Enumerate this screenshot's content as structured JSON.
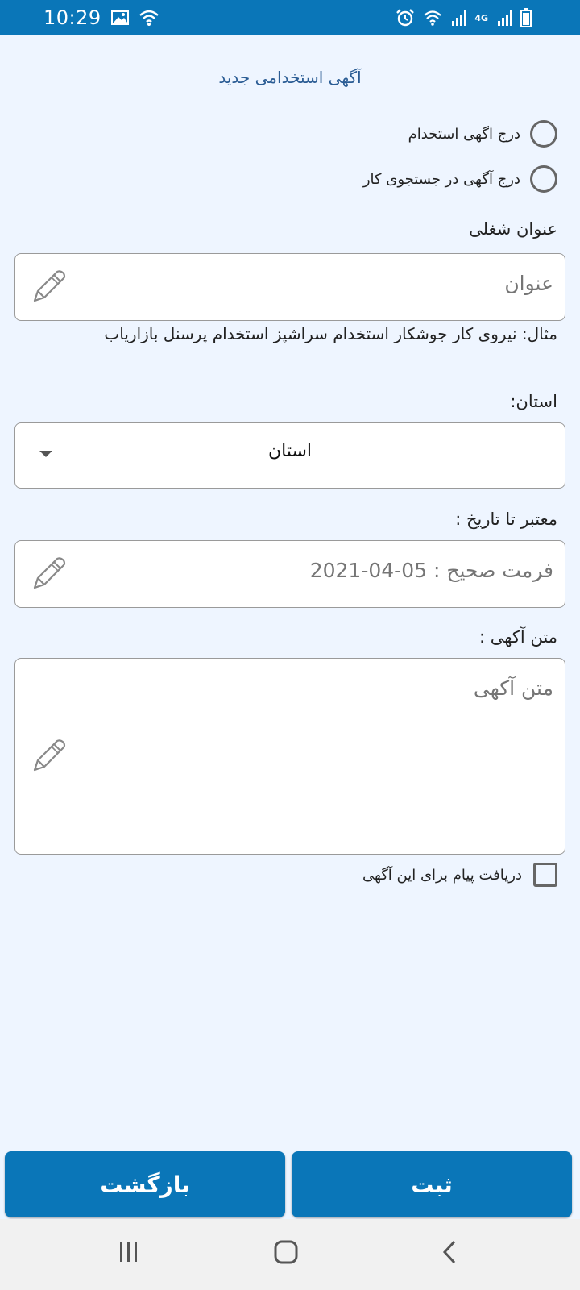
{
  "status_bar": {
    "time": "10:29",
    "network_label": "4G",
    "icons": [
      "image-icon",
      "wifi-icon",
      "alarm-icon",
      "wifi-icon",
      "signal-icon",
      "signal-icon",
      "battery-icon"
    ]
  },
  "page": {
    "title": "آگهی استخدامی جدید"
  },
  "radio_options": [
    {
      "label": "درج اگهی استخدام",
      "selected": false
    },
    {
      "label": "درج آگهی در جستجوی کار",
      "selected": false
    }
  ],
  "job_title": {
    "label": "عنوان شغلی",
    "placeholder": "عنوان",
    "hint": "مثال: نیروی کار جوشکار استخدام سراشپز استخدام پرسنل بازاریاب"
  },
  "province": {
    "label": "استان:",
    "selected": "استان"
  },
  "valid_until": {
    "label": "معتبر تا تاریخ :",
    "placeholder": "فرمت صحیح : 05-04-2021"
  },
  "ad_text": {
    "label": "متن آکهی :",
    "placeholder": "متن آکهی"
  },
  "receive_messages": {
    "label": "دریافت پیام برای این آگهی",
    "checked": false
  },
  "buttons": {
    "back": "بازگشت",
    "submit": "ثبت"
  },
  "colors": {
    "primary": "#0a76b8",
    "background": "#eef5ff",
    "title": "#2a5c94"
  }
}
